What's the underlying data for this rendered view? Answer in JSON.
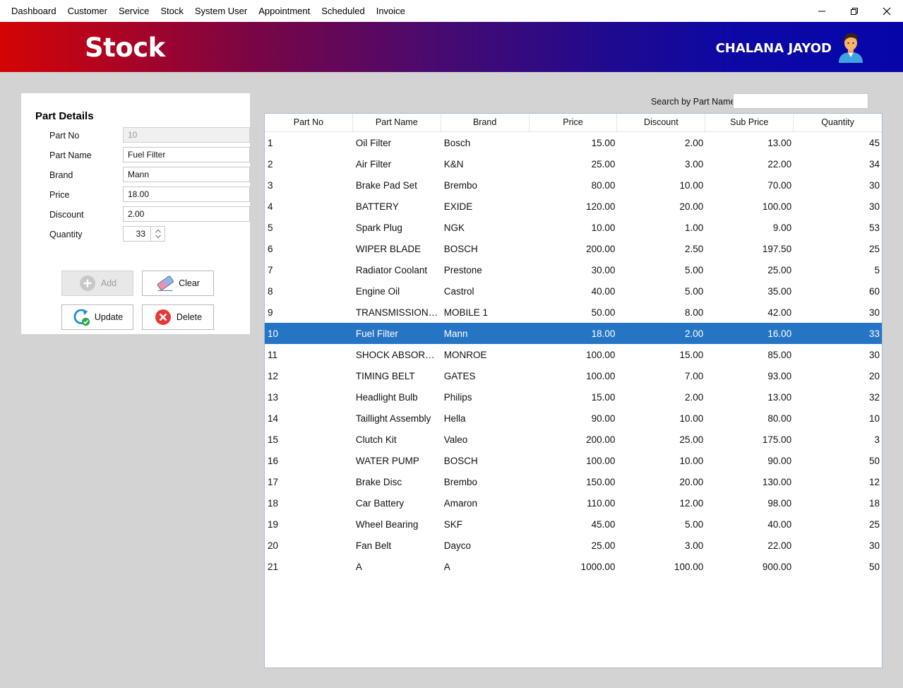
{
  "menu": [
    "Dashboard",
    "Customer",
    "Service",
    "Stock",
    "System User",
    "Appointment",
    "Scheduled",
    "Invoice"
  ],
  "header": {
    "title": "Stock",
    "user_name": "CHALANA JAYOD"
  },
  "form": {
    "title": "Part Details",
    "labels": {
      "part_no": "Part No",
      "part_name": "Part Name",
      "brand": "Brand",
      "price": "Price",
      "discount": "Discount",
      "quantity": "Quantity"
    },
    "values": {
      "part_no": "10",
      "part_name": "Fuel Filter",
      "brand": "Mann",
      "price": "18.00",
      "discount": "2.00",
      "quantity": "33"
    }
  },
  "buttons": {
    "add": "Add",
    "clear": "Clear",
    "update": "Update",
    "delete": "Delete"
  },
  "search": {
    "label": "Search by Part Name",
    "value": ""
  },
  "table": {
    "columns": [
      "Part No",
      "Part Name",
      "Brand",
      "Price",
      "Discount",
      "Sub Price",
      "Quantity"
    ],
    "selected_row": 9,
    "rows": [
      [
        "1",
        "Oil Filter",
        "Bosch",
        "15.00",
        "2.00",
        "13.00",
        "45"
      ],
      [
        "2",
        "Air Filter",
        "K&N",
        "25.00",
        "3.00",
        "22.00",
        "34"
      ],
      [
        "3",
        "Brake Pad Set",
        "Brembo",
        "80.00",
        "10.00",
        "70.00",
        "30"
      ],
      [
        "4",
        "BATTERY",
        "EXIDE",
        "120.00",
        "20.00",
        "100.00",
        "30"
      ],
      [
        "5",
        "Spark Plug",
        "NGK",
        "10.00",
        "1.00",
        "9.00",
        "53"
      ],
      [
        "6",
        "WIPER BLADE",
        "BOSCH",
        "200.00",
        "2.50",
        "197.50",
        "25"
      ],
      [
        "7",
        "Radiator Coolant",
        "Prestone",
        "30.00",
        "5.00",
        "25.00",
        "5"
      ],
      [
        "8",
        "Engine Oil",
        "Castrol",
        "40.00",
        "5.00",
        "35.00",
        "60"
      ],
      [
        "9",
        "TRANSMISSION ...",
        "MOBILE 1",
        "50.00",
        "8.00",
        "42.00",
        "30"
      ],
      [
        "10",
        "Fuel Filter",
        "Mann",
        "18.00",
        "2.00",
        "16.00",
        "33"
      ],
      [
        "11",
        "SHOCK ABSORBER",
        "MONROE",
        "100.00",
        "15.00",
        "85.00",
        "30"
      ],
      [
        "12",
        "TIMING BELT",
        "GATES",
        "100.00",
        "7.00",
        "93.00",
        "20"
      ],
      [
        "13",
        "Headlight Bulb",
        "Philips",
        "15.00",
        "2.00",
        "13.00",
        "32"
      ],
      [
        "14",
        "Taillight Assembly",
        "Hella",
        "90.00",
        "10.00",
        "80.00",
        "10"
      ],
      [
        "15",
        "Clutch Kit",
        "Valeo",
        "200.00",
        "25.00",
        "175.00",
        "3"
      ],
      [
        "16",
        "WATER PUMP",
        "BOSCH",
        "100.00",
        "10.00",
        "90.00",
        "50"
      ],
      [
        "17",
        "Brake Disc",
        "Brembo",
        "150.00",
        "20.00",
        "130.00",
        "12"
      ],
      [
        "18",
        "Car Battery",
        "Amaron",
        "110.00",
        "12.00",
        "98.00",
        "18"
      ],
      [
        "19",
        "Wheel Bearing",
        "SKF",
        "45.00",
        "5.00",
        "40.00",
        "25"
      ],
      [
        "20",
        "Fan Belt",
        "Dayco",
        "25.00",
        "3.00",
        "22.00",
        "30"
      ],
      [
        "21",
        "A",
        "A",
        "1000.00",
        "100.00",
        "900.00",
        "50"
      ]
    ]
  },
  "colors": {
    "selection": "#2675c5",
    "header_start": "#d40404",
    "header_end": "#0606a8"
  },
  "icons": [
    "minimize-icon",
    "maximize-icon",
    "close-icon",
    "user-avatar-icon",
    "add-icon",
    "eraser-icon",
    "refresh-check-icon",
    "delete-x-icon"
  ]
}
